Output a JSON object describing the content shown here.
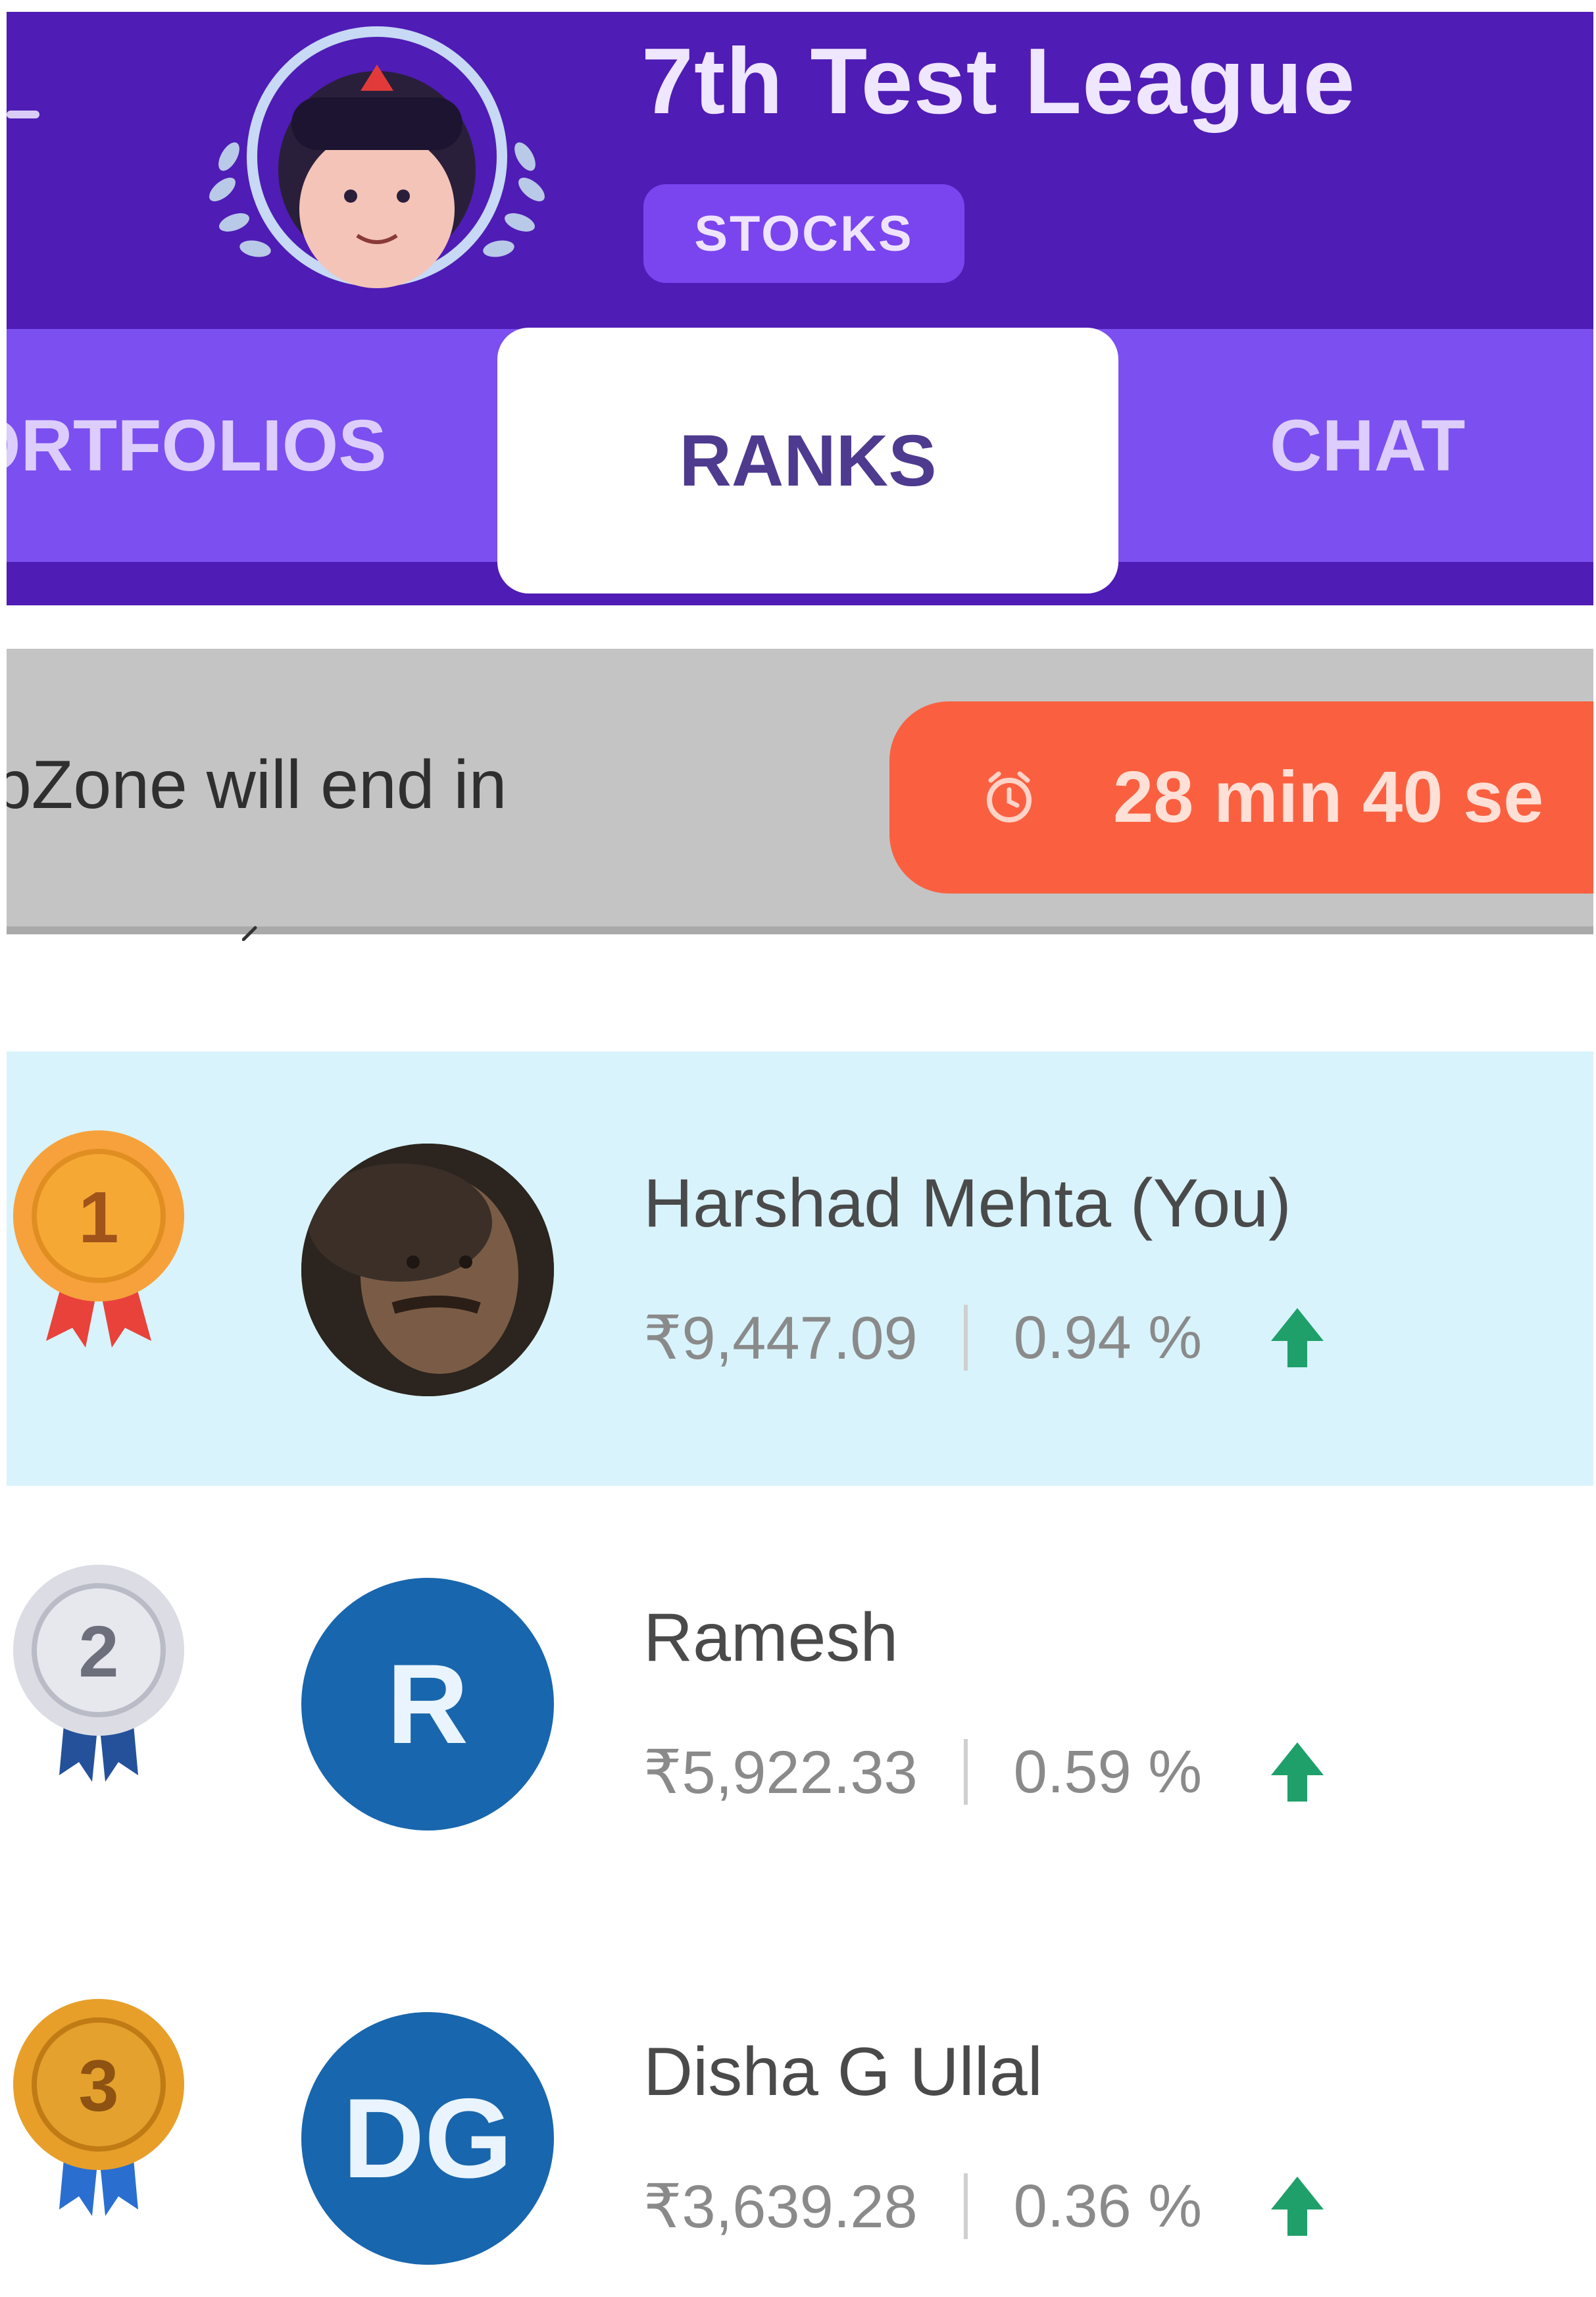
{
  "header": {
    "league_title": "7th Test League",
    "category": "STOCKS"
  },
  "tabs": [
    {
      "label": "ORTFOLIOS",
      "active": false
    },
    {
      "label": "RANKS",
      "active": true
    },
    {
      "label": "CHAT",
      "active": false
    }
  ],
  "countdown": {
    "text": "pZone will end in",
    "timer": "28 min 40 se"
  },
  "ranks": [
    {
      "rank": "1",
      "name": "Harshad Mehta  (You)",
      "amount": "₹9,447.09",
      "percent": "0.94 %",
      "initials": "",
      "medal": "gold",
      "trend": "up"
    },
    {
      "rank": "2",
      "name": "Ramesh",
      "amount": "₹5,922.33",
      "percent": "0.59 %",
      "initials": "R",
      "medal": "silver",
      "trend": "up"
    },
    {
      "rank": "3",
      "name": "Disha G Ullal",
      "amount": "₹3,639.28",
      "percent": "0.36 %",
      "initials": "DG",
      "medal": "bronze",
      "trend": "up"
    }
  ],
  "colors": {
    "header_bg": "#4f1cb5",
    "tab_bg": "#7c4ff0",
    "chip_bg": "#7a45ee",
    "timer_bg": "#fa6040",
    "highlight_row": "#d8f3fb",
    "avatar_initials_bg": "#1866ad",
    "trend_up": "#1f9f6a"
  },
  "icons": {
    "back": "arrow-left-icon",
    "timer": "alarm-clock-icon",
    "trend": "trend-up-icon",
    "medal": "rank-medal-icon"
  }
}
